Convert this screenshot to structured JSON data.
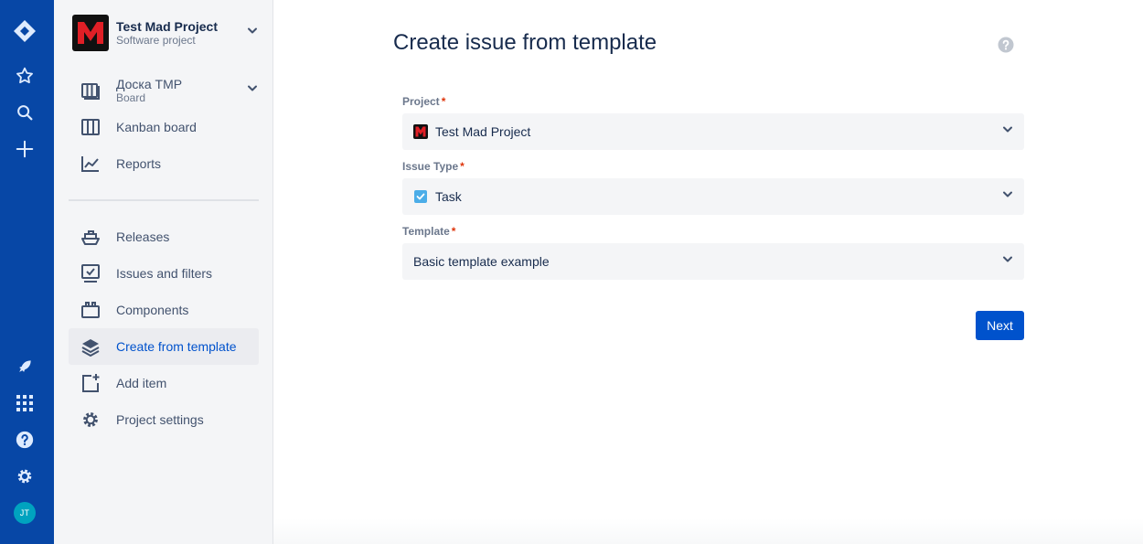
{
  "project": {
    "name": "Test Mad Project",
    "type": "Software project"
  },
  "board": {
    "name": "Доска TMP",
    "sub": "Board"
  },
  "sidebar": {
    "items": [
      {
        "label": "Kanban board",
        "icon": "kanban-board-icon"
      },
      {
        "label": "Reports",
        "icon": "reports-icon"
      },
      {
        "label": "Releases",
        "icon": "releases-icon"
      },
      {
        "label": "Issues and filters",
        "icon": "issues-filters-icon"
      },
      {
        "label": "Components",
        "icon": "components-icon"
      },
      {
        "label": "Create from template",
        "icon": "template-stack-icon",
        "selected": true
      },
      {
        "label": "Add item",
        "icon": "add-item-icon"
      },
      {
        "label": "Project settings",
        "icon": "gear-icon"
      }
    ]
  },
  "global_nav": {
    "avatar_initials": "JT"
  },
  "main": {
    "title": "Create issue from template",
    "fields": [
      {
        "label": "Project",
        "required": "*",
        "value": "Test Mad Project"
      },
      {
        "label": "Issue Type",
        "required": "*",
        "value": "Task"
      },
      {
        "label": "Template",
        "required": "*",
        "value": "Basic template example"
      }
    ],
    "next_label": "Next"
  },
  "colors": {
    "nav": "#0747a6",
    "primary": "#0052cc",
    "required": "#de350b",
    "project_logo": "#e01f26",
    "task": "#4bade8"
  }
}
